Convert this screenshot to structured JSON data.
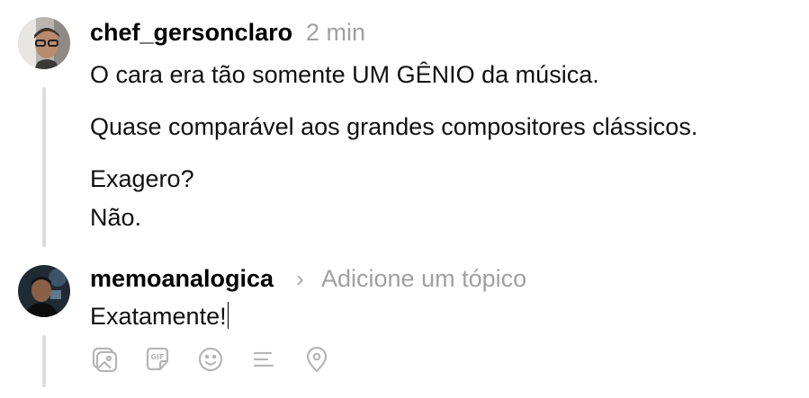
{
  "post": {
    "username": "chef_gersonclaro",
    "time": "2 min",
    "paragraphs": [
      "O cara era tão somente UM GÊNIO da música.",
      "Quase comparável aos grandes compositores clássicos.",
      "Exagero?",
      "Não."
    ]
  },
  "reply": {
    "username": "memoanalogica",
    "topic_placeholder": "Adicione um tópico",
    "text": "Exatamente!"
  },
  "toolbar": {
    "icons": [
      "image-icon",
      "gif-icon",
      "emoji-icon",
      "poll-icon",
      "location-icon"
    ],
    "gif_label": "GIF"
  }
}
